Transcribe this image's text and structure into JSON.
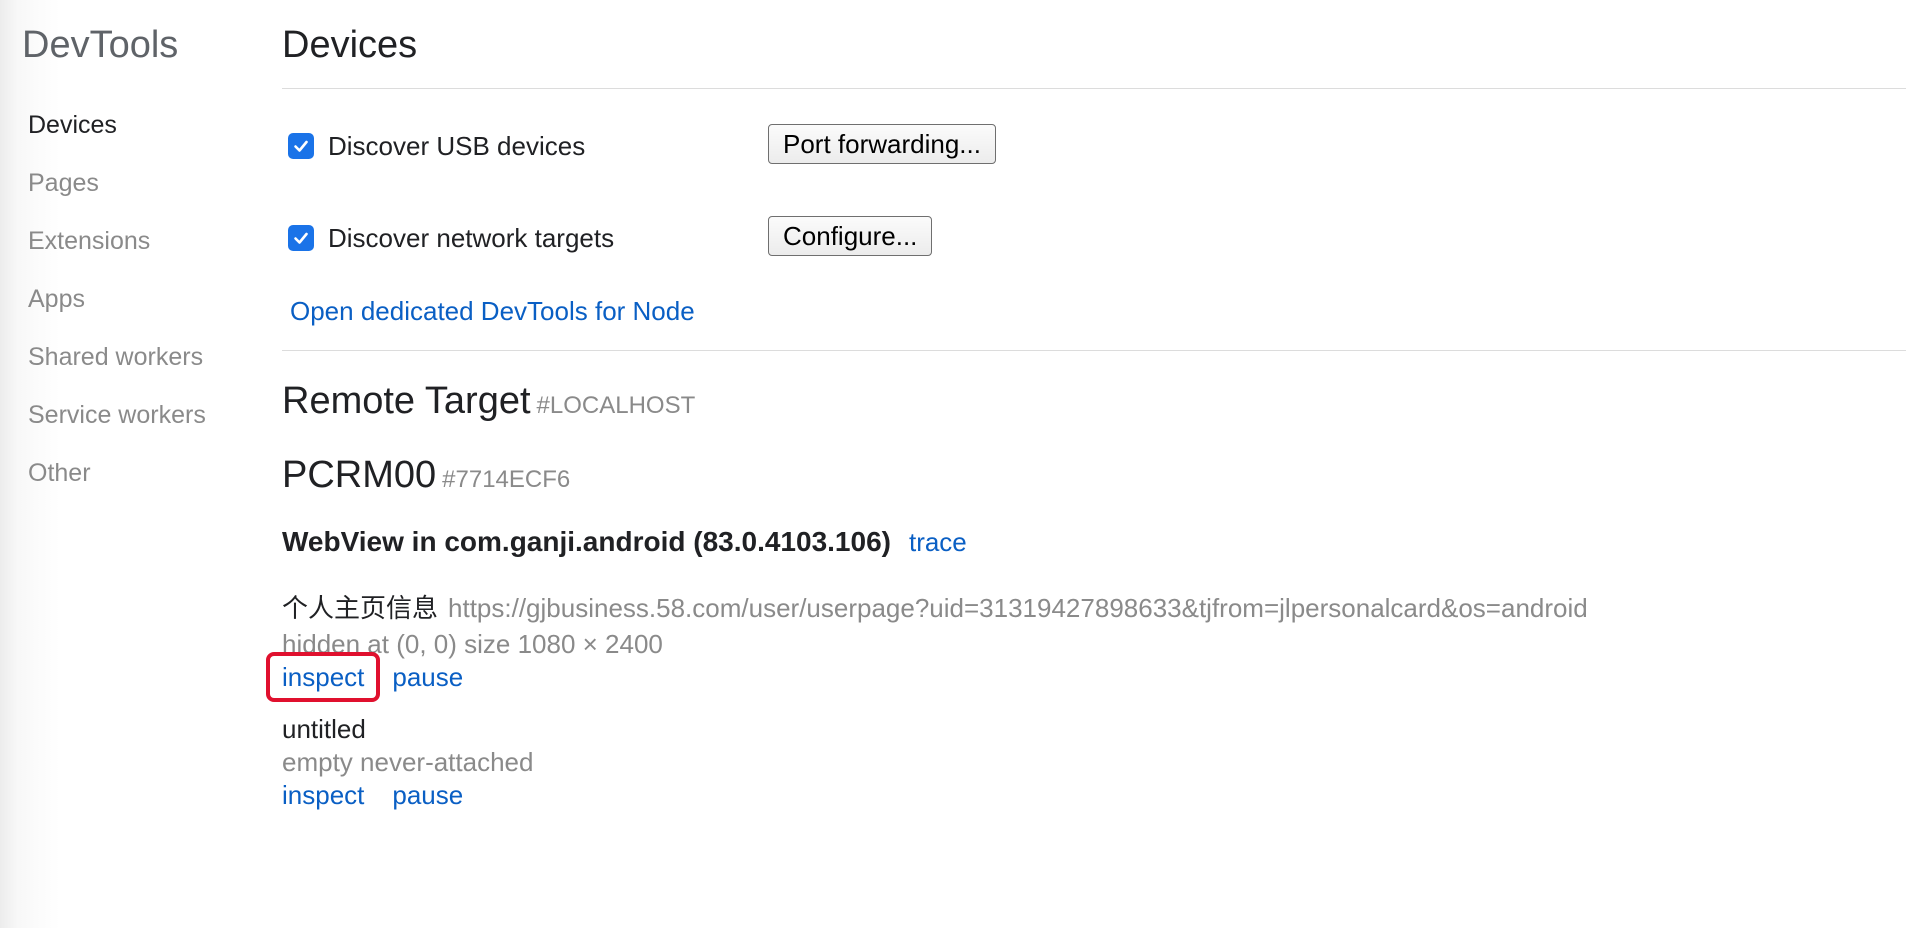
{
  "sidebar": {
    "title": "DevTools",
    "items": [
      {
        "label": "Devices",
        "active": true
      },
      {
        "label": "Pages",
        "active": false
      },
      {
        "label": "Extensions",
        "active": false
      },
      {
        "label": "Apps",
        "active": false
      },
      {
        "label": "Shared workers",
        "active": false
      },
      {
        "label": "Service workers",
        "active": false
      },
      {
        "label": "Other",
        "active": false
      }
    ]
  },
  "main": {
    "title": "Devices",
    "options": {
      "usb": {
        "label": "Discover USB devices",
        "checked": true,
        "button": "Port forwarding..."
      },
      "network": {
        "label": "Discover network targets",
        "checked": true,
        "button": "Configure..."
      }
    },
    "node_link": "Open dedicated DevTools for Node",
    "remote_target": {
      "title": "Remote Target",
      "tag": "#LOCALHOST"
    },
    "device": {
      "name": "PCRM00",
      "serial": "#7714ECF6"
    },
    "browser": {
      "name": "WebView in com.ganji.android (83.0.4103.106)",
      "trace_label": "trace"
    },
    "targets": [
      {
        "title": "个人主页信息",
        "url": "https://gjbusiness.58.com/user/userpage?uid=31319427898633&tjfrom=jlpersonalcard&os=android",
        "meta": "hidden  at (0, 0)  size 1080 × 2400",
        "inspect_label": "inspect",
        "pause_label": "pause",
        "highlighted": true
      },
      {
        "title": "untitled",
        "url": "",
        "meta": "empty never-attached",
        "inspect_label": "inspect",
        "pause_label": "pause",
        "highlighted": false
      }
    ]
  },
  "colors": {
    "link": "#0a5fc4",
    "checkbox": "#1a73e8",
    "highlight": "#e0102e",
    "muted": "#8a8a8a"
  }
}
